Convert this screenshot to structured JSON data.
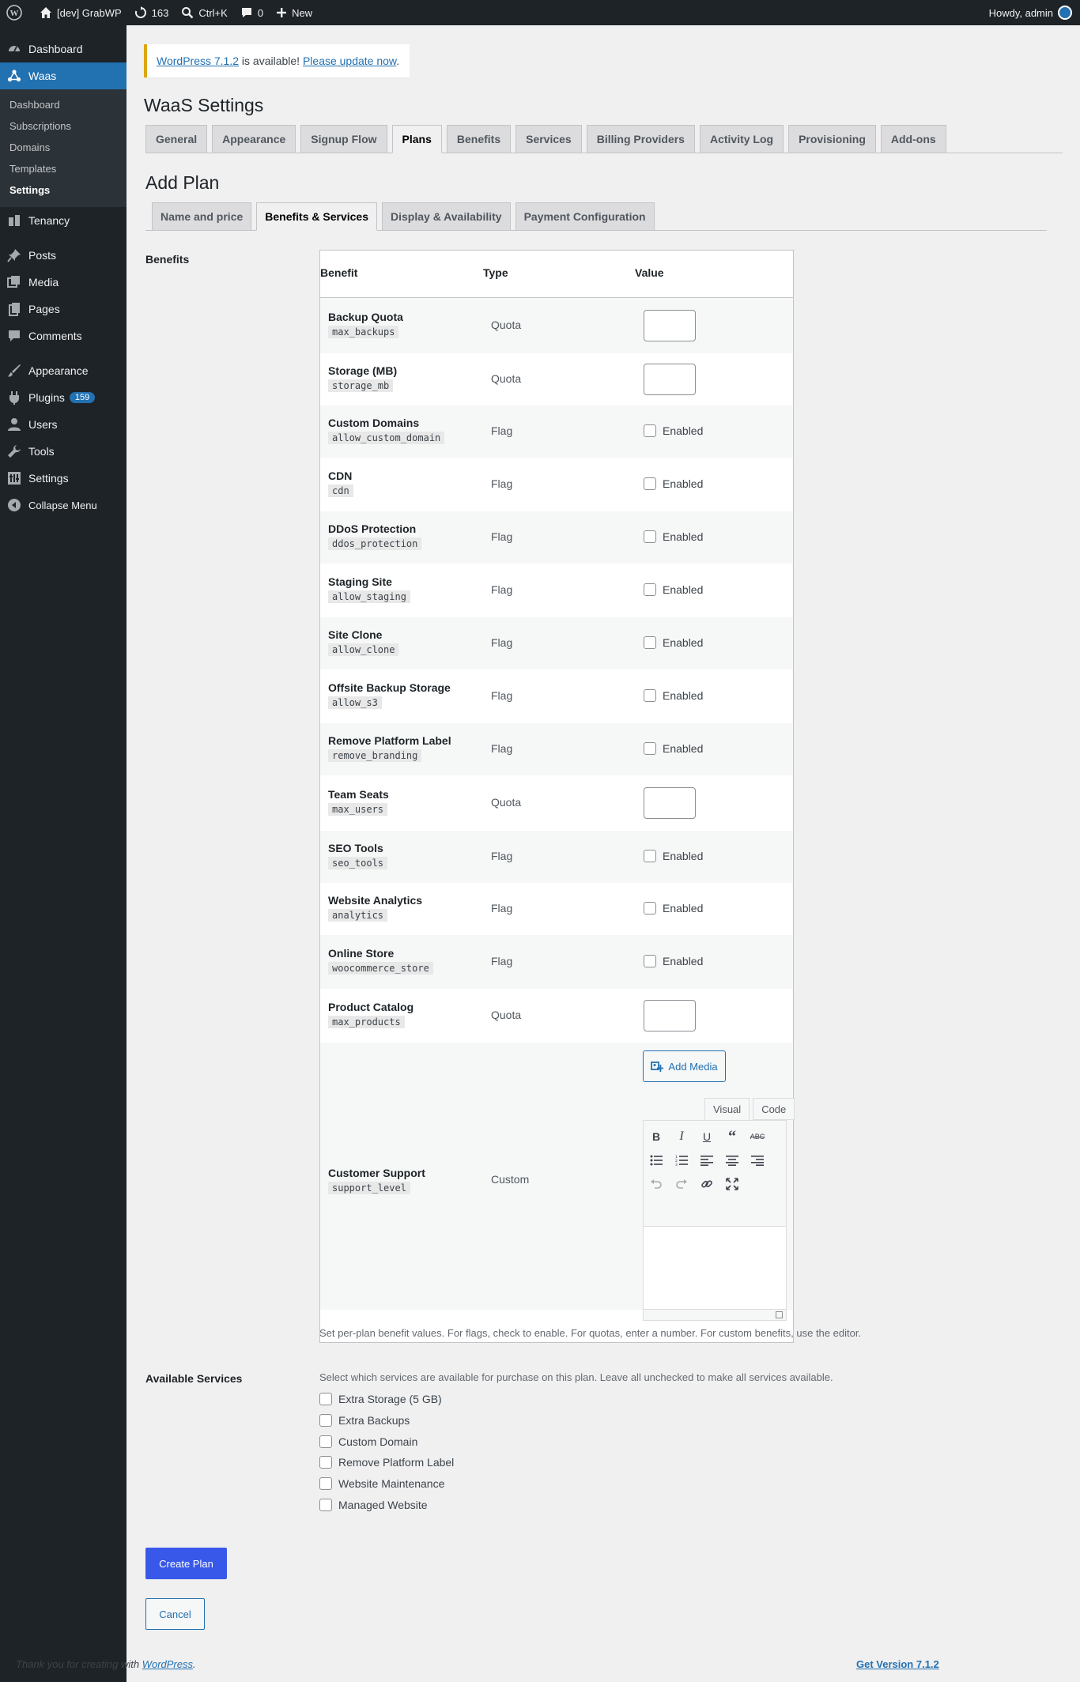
{
  "adminbar": {
    "site_name": "[dev] GrabWP",
    "updates_count": "163",
    "search_shortcut": "Ctrl+K",
    "comments_count": "0",
    "new_label": "New",
    "howdy": "Howdy, admin"
  },
  "sidebar": {
    "dashboard": "Dashboard",
    "waas": "Waas",
    "waas_sub": [
      "Dashboard",
      "Subscriptions",
      "Domains",
      "Templates",
      "Settings"
    ],
    "tenancy": "Tenancy",
    "posts": "Posts",
    "media": "Media",
    "pages": "Pages",
    "comments": "Comments",
    "appearance": "Appearance",
    "plugins": "Plugins",
    "plugins_badge": "159",
    "users": "Users",
    "tools": "Tools",
    "settings": "Settings",
    "collapse": "Collapse Menu"
  },
  "notice": {
    "version_link": "WordPress 7.1.2",
    "middle": " is available! ",
    "update_link": "Please update now",
    "end": "."
  },
  "page_title": "WaaS Settings",
  "tabs": [
    "General",
    "Appearance",
    "Signup Flow",
    "Plans",
    "Benefits",
    "Services",
    "Billing Providers",
    "Activity Log",
    "Provisioning",
    "Add-ons"
  ],
  "active_tab": "Plans",
  "section_title": "Add Plan",
  "sub_tabs": [
    "Name and price",
    "Benefits & Services",
    "Display & Availability",
    "Payment Configuration"
  ],
  "active_sub_tab": "Benefits & Services",
  "benefits": {
    "label": "Benefits",
    "headers": {
      "benefit": "Benefit",
      "type": "Type",
      "value": "Value"
    },
    "enabled_label": "Enabled",
    "rows": [
      {
        "name": "Backup Quota",
        "key": "max_backups",
        "type": "Quota",
        "value": ""
      },
      {
        "name": "Storage (MB)",
        "key": "storage_mb",
        "type": "Quota",
        "value": ""
      },
      {
        "name": "Custom Domains",
        "key": "allow_custom_domain",
        "type": "Flag",
        "checked": false
      },
      {
        "name": "CDN",
        "key": "cdn",
        "type": "Flag",
        "checked": false
      },
      {
        "name": "DDoS Protection",
        "key": "ddos_protection",
        "type": "Flag",
        "checked": false
      },
      {
        "name": "Staging Site",
        "key": "allow_staging",
        "type": "Flag",
        "checked": false
      },
      {
        "name": "Site Clone",
        "key": "allow_clone",
        "type": "Flag",
        "checked": false
      },
      {
        "name": "Offsite Backup Storage",
        "key": "allow_s3",
        "type": "Flag",
        "checked": false
      },
      {
        "name": "Remove Platform Label",
        "key": "remove_branding",
        "type": "Flag",
        "checked": false
      },
      {
        "name": "Team Seats",
        "key": "max_users",
        "type": "Quota",
        "value": ""
      },
      {
        "name": "SEO Tools",
        "key": "seo_tools",
        "type": "Flag",
        "checked": false
      },
      {
        "name": "Website Analytics",
        "key": "analytics",
        "type": "Flag",
        "checked": false
      },
      {
        "name": "Online Store",
        "key": "woocommerce_store",
        "type": "Flag",
        "checked": false
      },
      {
        "name": "Product Catalog",
        "key": "max_products",
        "type": "Quota",
        "value": ""
      }
    ],
    "custom_row": {
      "name": "Customer Support",
      "key": "support_level",
      "type": "Custom"
    },
    "add_media": "Add Media",
    "editor_tabs": [
      "Visual",
      "Code"
    ],
    "description": "Set per-plan benefit values. For flags, check to enable. For quotas, enter a number. For custom benefits, use the editor."
  },
  "services": {
    "label": "Available Services",
    "description": "Select which services are available for purchase on this plan. Leave all unchecked to make all services available.",
    "items": [
      "Extra Storage (5 GB)",
      "Extra Backups",
      "Custom Domain",
      "Remove Platform Label",
      "Website Maintenance",
      "Managed Website"
    ]
  },
  "buttons": {
    "create": "Create Plan",
    "cancel": "Cancel"
  },
  "footer": {
    "thanks_pre": "Thank you for creating with ",
    "thanks_link": "WordPress",
    "thanks_post": ".",
    "version": "Get Version 7.1.2"
  },
  "colors": {
    "admin_dark": "#1d2327",
    "accent": "#2271b1",
    "primary_button": "#3858e9",
    "notice_border": "#dba617"
  }
}
